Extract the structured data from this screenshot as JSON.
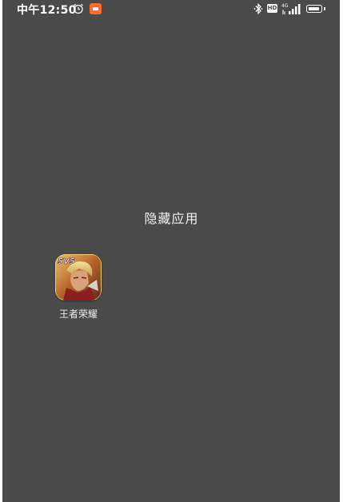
{
  "status_bar": {
    "time": "中午12:50",
    "hd_label": "HD",
    "network_label": "4G",
    "icons": [
      "alarm-icon",
      "screen-record-icon",
      "bluetooth-icon",
      "hd-voice-icon",
      "signal-icon",
      "battery-icon"
    ]
  },
  "page": {
    "title": "隐藏应用"
  },
  "apps": [
    {
      "label": "王者荣耀",
      "icon": "game-app-icon",
      "badge": "5V5"
    }
  ],
  "colors": {
    "background": "#4a4a4a",
    "text": "#ffffff",
    "record_badge": "#ff6a2a"
  }
}
